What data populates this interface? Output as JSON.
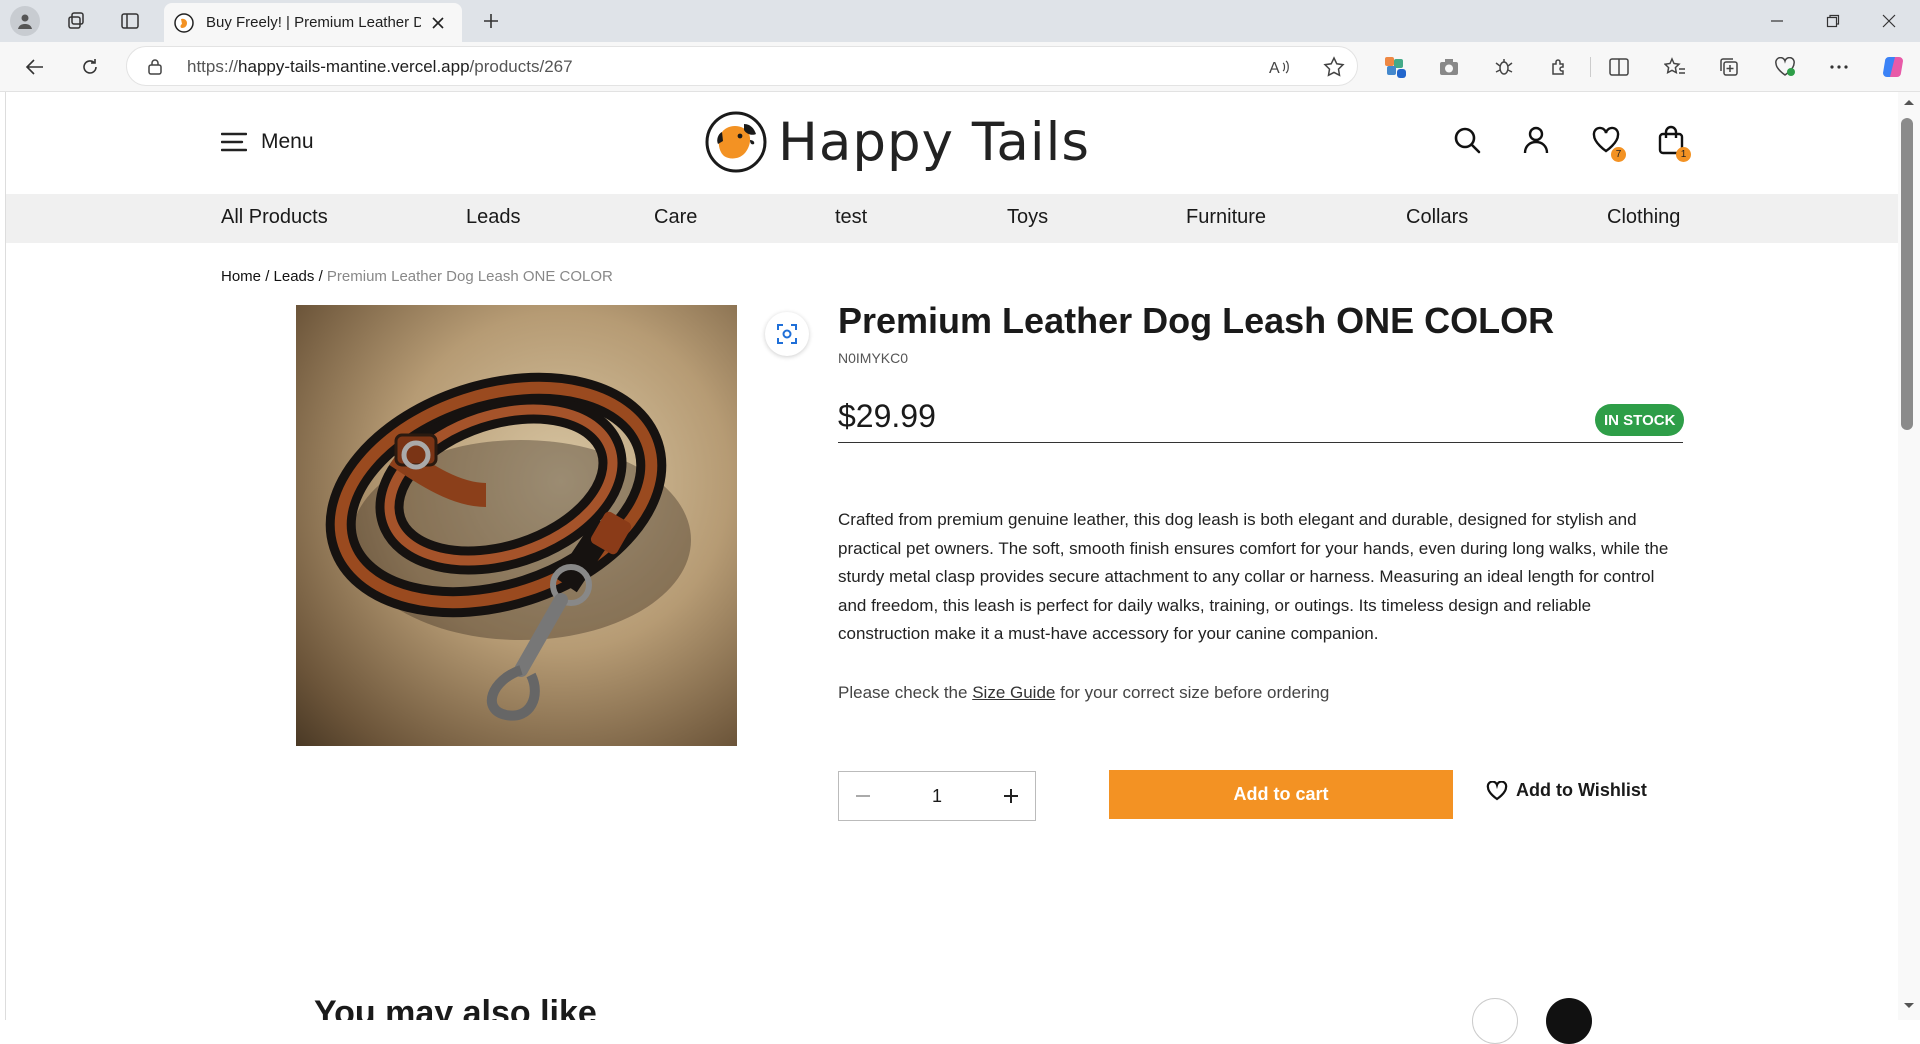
{
  "browser": {
    "tab_title": "Buy Freely! | Premium Leather Dog Leash ONE COLOR",
    "url_prefix": "https://",
    "url_host": "happy-tails-mantine.vercel.app",
    "url_path": "/products/267"
  },
  "header": {
    "menu_label": "Menu",
    "logo_text": "Happy Tails",
    "wishlist_count": "7",
    "cart_count": "1"
  },
  "nav": [
    "All Products",
    "Leads",
    "Care",
    "test",
    "Toys",
    "Furniture",
    "Collars",
    "Clothing"
  ],
  "breadcrumb": {
    "home": "Home",
    "sep": "/",
    "category": "Leads",
    "current": "Premium Leather Dog Leash ONE COLOR"
  },
  "product": {
    "title": "Premium Leather Dog Leash ONE COLOR",
    "sku": "N0IMYKC0",
    "price": "$29.99",
    "stock": "IN STOCK",
    "description": "Crafted from premium genuine leather, this dog leash is both elegant and durable, designed for stylish and practical pet owners. The soft, smooth finish ensures comfort for your hands, even during long walks, while the sturdy metal clasp provides secure attachment to any collar or harness. Measuring an ideal length for control and freedom, this leash is perfect for daily walks, training, or outings. Its timeless design and reliable construction make it a must-have accessory for your canine companion.",
    "size_guide_pre": "Please check the ",
    "size_guide_link": "Size Guide",
    "size_guide_post": " for your correct size before ordering",
    "quantity": "1",
    "add_to_cart": "Add to cart",
    "add_to_wishlist": "Add to Wishlist"
  },
  "section_below": {
    "title": "You may also like"
  },
  "colors": {
    "accent": "#f39223",
    "stock": "#2e9e48"
  }
}
